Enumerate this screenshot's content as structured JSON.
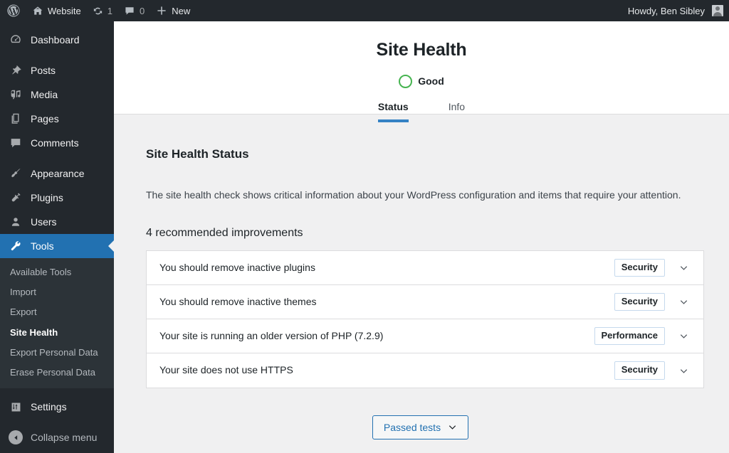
{
  "adminbar": {
    "wp_logo_icon": "wordpress-logo-icon",
    "site_icon": "home-icon",
    "site_name": "Website",
    "updates_icon": "updates-icon",
    "updates_count": "1",
    "comments_icon": "comment-bubble-icon",
    "comments_count": "0",
    "new_icon": "plus-icon",
    "new_label": "New",
    "howdy": "Howdy, Ben Sibley",
    "avatar_icon": "user-avatar"
  },
  "sidebar": {
    "items": [
      {
        "label": "Dashboard",
        "icon": "dashboard-icon"
      },
      {
        "label": "Posts",
        "icon": "pin-icon"
      },
      {
        "label": "Media",
        "icon": "media-icon"
      },
      {
        "label": "Pages",
        "icon": "pages-icon"
      },
      {
        "label": "Comments",
        "icon": "comment-bubble-icon"
      },
      {
        "label": "Appearance",
        "icon": "paintbrush-icon"
      },
      {
        "label": "Plugins",
        "icon": "plug-icon"
      },
      {
        "label": "Users",
        "icon": "user-icon"
      },
      {
        "label": "Tools",
        "icon": "wrench-icon"
      },
      {
        "label": "Settings",
        "icon": "sliders-icon"
      }
    ],
    "tools_submenu": [
      {
        "label": "Available Tools"
      },
      {
        "label": "Import"
      },
      {
        "label": "Export"
      },
      {
        "label": "Site Health"
      },
      {
        "label": "Export Personal Data"
      },
      {
        "label": "Erase Personal Data"
      }
    ],
    "collapse": {
      "label": "Collapse menu",
      "icon": "collapse-arrow-icon"
    }
  },
  "health": {
    "title": "Site Health",
    "status_label": "Good",
    "status_color": "#46b450",
    "tabs": [
      {
        "label": "Status",
        "active": true
      },
      {
        "label": "Info",
        "active": false
      }
    ],
    "section_heading": "Site Health Status",
    "description": "The site health check shows critical information about your WordPress configuration and items that require your attention.",
    "improvements_heading": "4 recommended improvements",
    "issues": [
      {
        "title": "You should remove inactive plugins",
        "badge": "Security",
        "chevron": "chevron-down-icon"
      },
      {
        "title": "You should remove inactive themes",
        "badge": "Security",
        "chevron": "chevron-down-icon"
      },
      {
        "title": "Your site is running an older version of PHP (7.2.9)",
        "badge": "Performance",
        "chevron": "chevron-down-icon"
      },
      {
        "title": "Your site does not use HTTPS",
        "badge": "Security",
        "chevron": "chevron-down-icon"
      }
    ],
    "passed_tests_label": "Passed tests",
    "passed_tests_icon": "chevron-down-icon",
    "accent_color": "#2271b1"
  }
}
